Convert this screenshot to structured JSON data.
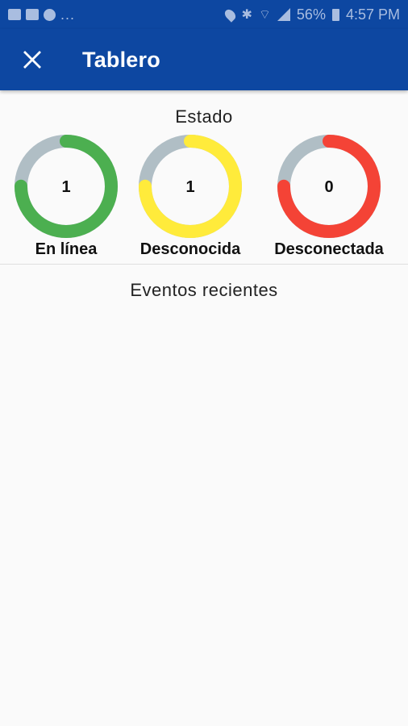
{
  "status_bar": {
    "notifications": "...",
    "battery": "56%",
    "time": "4:57 PM"
  },
  "app_bar": {
    "title": "Tablero",
    "close_icon": "close-icon"
  },
  "status_section": {
    "title": "Estado",
    "items": [
      {
        "label": "En línea",
        "value": "1",
        "fraction": 0.75,
        "color": "#4caf50"
      },
      {
        "label": "Desconocida",
        "value": "1",
        "fraction": 0.75,
        "color": "#ffeb3b"
      },
      {
        "label": "Desconectada",
        "value": "0",
        "fraction": 0.75,
        "color": "#f44336"
      }
    ],
    "track_color": "#b0bec5"
  },
  "events_section": {
    "title": "Eventos recientes"
  },
  "colors": {
    "primary": "#0d47a1",
    "background": "#fafafa"
  }
}
